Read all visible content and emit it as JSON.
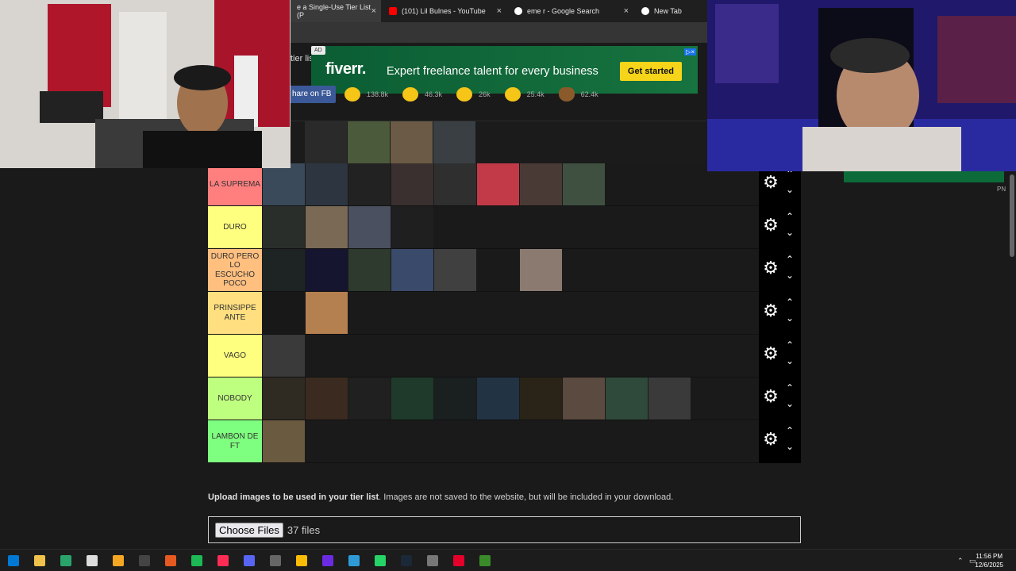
{
  "browser": {
    "tabs": [
      {
        "title": "e a Single-Use Tier List (P",
        "close": "×",
        "active": true,
        "color": "#e8e8e8"
      },
      {
        "title": "(101) Lil Bulnes - YouTube",
        "close": "×",
        "active": false,
        "color": "#ff0000"
      },
      {
        "title": "eme r - Google Search",
        "close": "×",
        "active": false,
        "color": "#ffffff"
      },
      {
        "title": "New Tab",
        "close": "",
        "active": false,
        "color": "#ffffff"
      }
    ]
  },
  "page": {
    "title_fragment": "tier lis",
    "share_label": "hare on FB",
    "reactions": [
      {
        "count": "138.8k",
        "icon": "grin-emoji-icon"
      },
      {
        "count": "46.3k",
        "icon": "smile-emoji-icon"
      },
      {
        "count": "26k",
        "icon": "laugh-emoji-icon"
      },
      {
        "count": "25.4k",
        "icon": "hands-emoji-icon"
      },
      {
        "count": "62.4k",
        "icon": "poo-emoji-icon"
      }
    ]
  },
  "ad": {
    "badge": "AD",
    "brand": "fiverr.",
    "headline": "Expert freelance talent for every business",
    "cta": "Get started",
    "info_icon": "▷×"
  },
  "pool": {
    "thumb_colors": [
      "#2a2a2a",
      "#4b5a3a",
      "#6b5a45",
      "#3a3f44"
    ]
  },
  "tiers": [
    {
      "label": "LA SUPREMA",
      "color": "#ff7f7f",
      "thumbs": [
        "#3a4a5a",
        "#2d3540",
        "#222",
        "#3a3030",
        "#2f2f2f",
        "#c23a48",
        "#4a3a35",
        "#3f5040"
      ]
    },
    {
      "label": "DURO",
      "color": "#ffff7f",
      "thumbs": [
        "#2a2e2a",
        "#7a6a55",
        "#4a5060",
        "#1f1f1f"
      ]
    },
    {
      "label": "DURO PERO LO ESCUCHO POCO",
      "color": "#ffbf7f",
      "thumbs": [
        "#1e2424",
        "#151530",
        "#2d3a2d",
        "#3a4a6a",
        "#404040",
        "#1a1a1a",
        "#8a7a70"
      ]
    },
    {
      "label": "PRINSIPPE ANTE",
      "color": "#ffdf7f",
      "thumbs": [
        "#181818",
        "#b58050"
      ]
    },
    {
      "label": "VAGO",
      "color": "#ffff7f",
      "thumbs": [
        "#3a3a3a"
      ]
    },
    {
      "label": "NOBODY",
      "color": "#bfff7f",
      "thumbs": [
        "#2f2a22",
        "#3a2a20",
        "#202020",
        "#1f3a2a",
        "#1a1f1f",
        "#223344",
        "#2a2418",
        "#5a4a40",
        "#2f4a3a",
        "#3a3a3a"
      ]
    },
    {
      "label": "LAMBON DE FT",
      "color": "#7fff7f",
      "thumbs": [
        "#6a5a40"
      ]
    }
  ],
  "tier_controls": {
    "gear_icon": "⚙",
    "up_icon": "⌃",
    "down_icon": "⌄"
  },
  "upload": {
    "bold": "Upload images to be used in your tier list",
    "rest": ". Images are not saved to the website, but will be included in your download.",
    "button": "Choose Files",
    "count": "37 files"
  },
  "overlay": {
    "pn_label": "PN"
  },
  "taskbar": {
    "time": "11:56 PM",
    "date": "12/6/2025",
    "icons": [
      "#0078d4",
      "#f0c14b",
      "#2aa36b",
      "#ddd",
      "#f5a623",
      "#444",
      "#e55a20",
      "#1db954",
      "#fe2c55",
      "#5865f2",
      "#666",
      "#fbbc05",
      "#6a2be2",
      "#2f9bd6",
      "#25d366",
      "#1b2838",
      "#777",
      "#e4002b",
      "#3a8a2a"
    ]
  }
}
